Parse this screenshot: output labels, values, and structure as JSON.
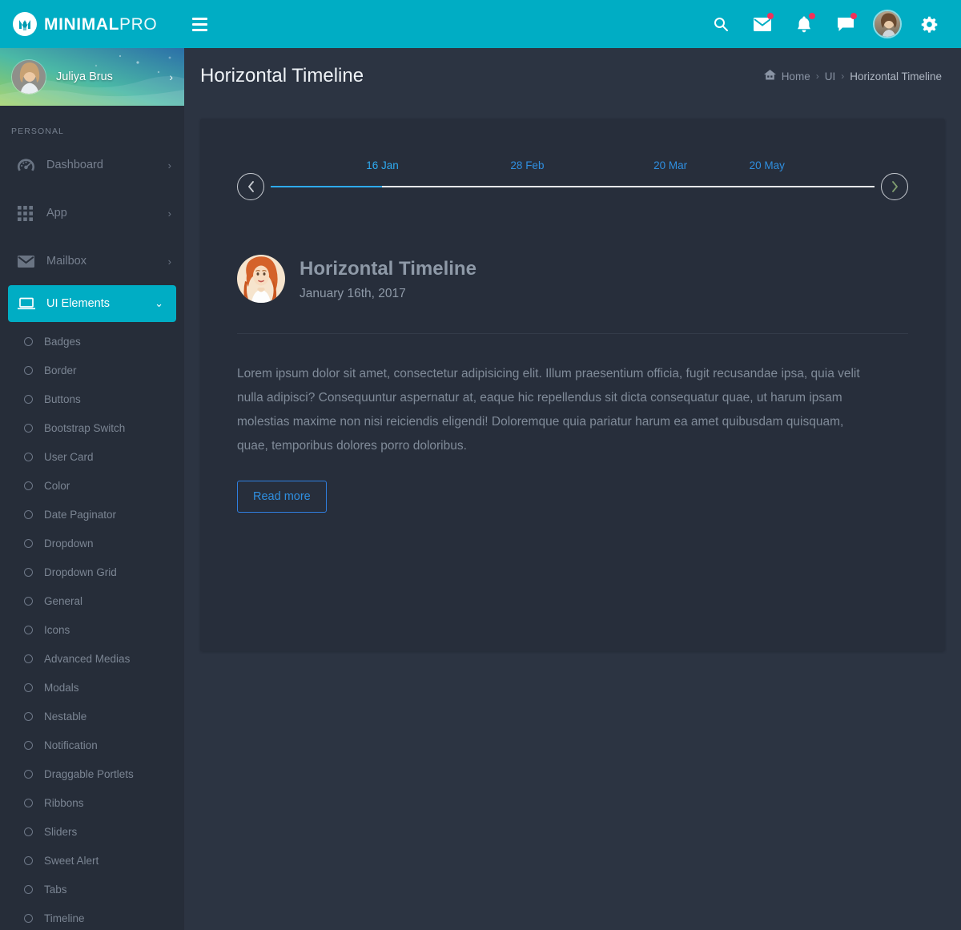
{
  "brand": {
    "name_bold": "MINIMAL",
    "name_light": "PRO",
    "logo_icon": "m-logo-icon"
  },
  "navbar": {
    "menu_toggle_icon": "hamburger-icon",
    "icons": [
      {
        "name": "search-icon",
        "badge": false
      },
      {
        "name": "envelope-icon",
        "badge": true
      },
      {
        "name": "bell-icon",
        "badge": true
      },
      {
        "name": "chat-icon",
        "badge": true
      }
    ],
    "avatar_icon": "user-avatar",
    "settings_icon": "gear-icon"
  },
  "sidebar": {
    "profile": {
      "name": "Juliya Brus",
      "chevron": "›",
      "avatar_icon": "user-avatar"
    },
    "section_label": "PERSONAL",
    "items": [
      {
        "label": "Dashboard",
        "icon": "speedometer-icon",
        "chevron": "›",
        "active": false
      },
      {
        "label": "App",
        "icon": "grid-icon",
        "chevron": "›",
        "active": false
      },
      {
        "label": "Mailbox",
        "icon": "envelope-icon",
        "chevron": "›",
        "active": false
      },
      {
        "label": "UI Elements",
        "icon": "laptop-icon",
        "chevron": "⌄",
        "active": true
      }
    ],
    "submenu": [
      {
        "label": "Badges"
      },
      {
        "label": "Border"
      },
      {
        "label": "Buttons"
      },
      {
        "label": "Bootstrap Switch"
      },
      {
        "label": "User Card"
      },
      {
        "label": "Color"
      },
      {
        "label": "Date Paginator"
      },
      {
        "label": "Dropdown"
      },
      {
        "label": "Dropdown Grid"
      },
      {
        "label": "General"
      },
      {
        "label": "Icons"
      },
      {
        "label": "Advanced Medias"
      },
      {
        "label": "Modals"
      },
      {
        "label": "Nestable"
      },
      {
        "label": "Notification"
      },
      {
        "label": "Draggable Portlets"
      },
      {
        "label": "Ribbons"
      },
      {
        "label": "Sliders"
      },
      {
        "label": "Sweet Alert"
      },
      {
        "label": "Tabs"
      },
      {
        "label": "Timeline"
      }
    ]
  },
  "page": {
    "title": "Horizontal Timeline",
    "breadcrumb": {
      "home_icon": "home-icon",
      "items": [
        "Home",
        "UI",
        "Horizontal Timeline"
      ],
      "separator": "›"
    }
  },
  "timeline": {
    "prev_icon": "chevron-left-icon",
    "next_icon": "chevron-right-icon",
    "fill_color": "#2eaaf0",
    "line_color": "#e6e8ea",
    "points": [
      {
        "date": "16 Jan",
        "position_pct": 18.5,
        "active": true
      },
      {
        "date": "28 Feb",
        "position_pct": 42.5,
        "active": false
      },
      {
        "date": "20 Mar",
        "position_pct": 66.2,
        "active": false
      },
      {
        "date": "20 May",
        "position_pct": 82.2,
        "active": false
      }
    ]
  },
  "entry": {
    "avatar_icon": "author-avatar",
    "title": "Horizontal Timeline",
    "date": "January 16th, 2017",
    "body": "Lorem ipsum dolor sit amet, consectetur adipisicing elit. Illum praesentium officia, fugit recusandae ipsa, quia velit nulla adipisci? Consequuntur aspernatur at, eaque hic repellendus sit dicta consequatur quae, ut harum ipsam molestias maxime non nisi reiciendis eligendi! Doloremque quia pariatur harum ea amet quibusdam quisquam, quae, temporibus dolores porro doloribus.",
    "read_more_label": "Read more"
  },
  "colors": {
    "brand": "#00adc4",
    "page_bg": "#2c3442",
    "card_bg": "#272e3b",
    "sidebar_bg": "#262d39",
    "accent_blue": "#2eaaf0",
    "badge_red": "#f0315b"
  }
}
